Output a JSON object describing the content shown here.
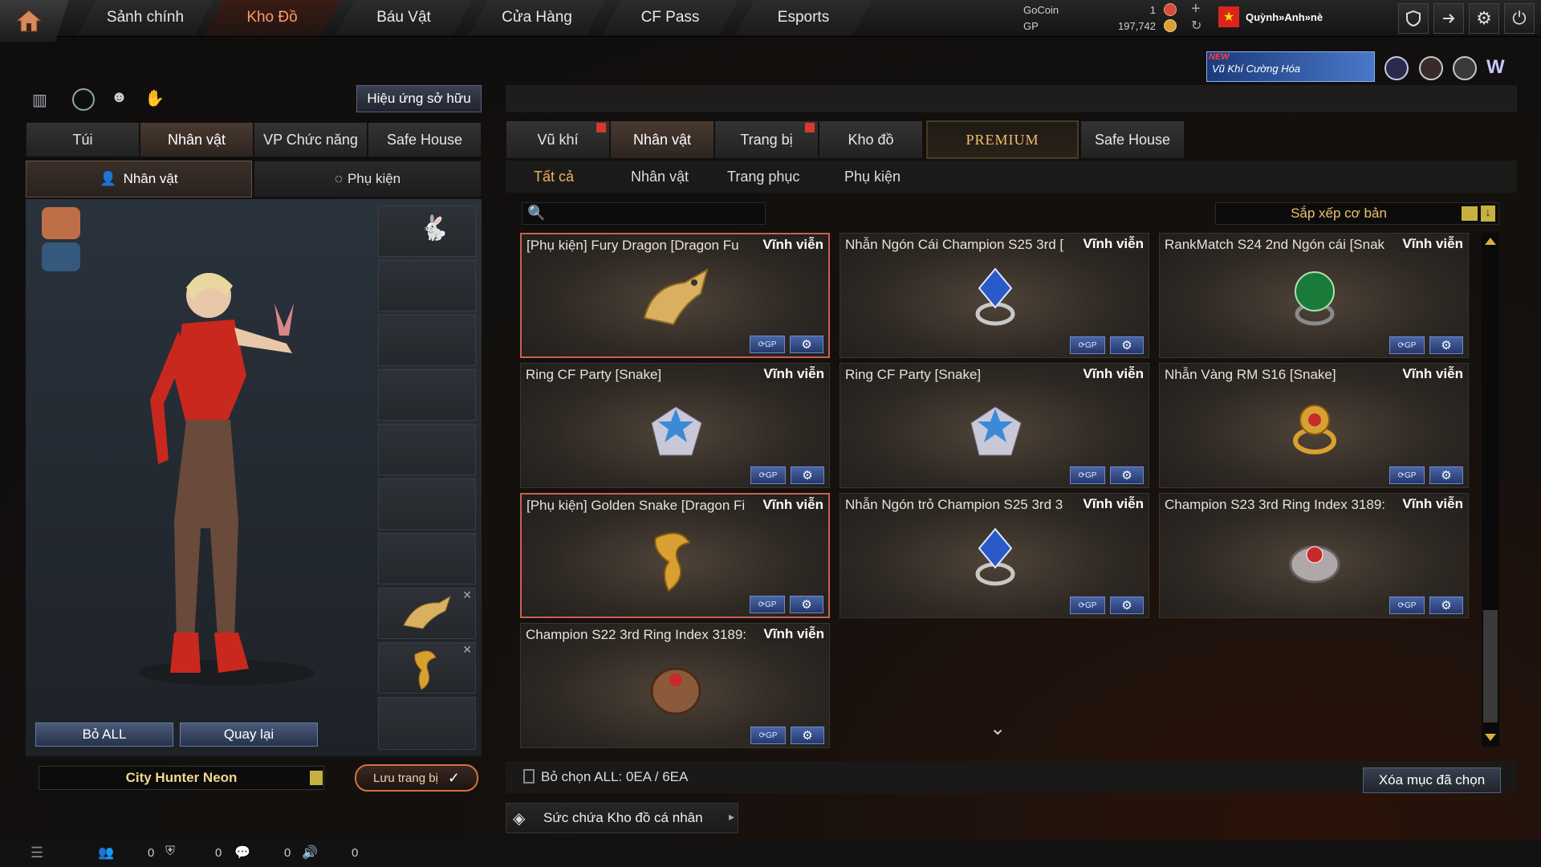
{
  "nav": {
    "tabs": [
      "Sảnh chính",
      "Kho Đồ",
      "Báu Vật",
      "Cửa Hàng",
      "CF Pass",
      "Esports"
    ],
    "active_index": 1
  },
  "currency": {
    "gocoin_label": "GoCoin",
    "gp_label": "GP",
    "gocoin_value": "1",
    "gp_value": "197,742"
  },
  "user": {
    "name": "Quỳnh»Anh»nè",
    "flag": "vn-flag-icon"
  },
  "promo": {
    "new_label": "NEW",
    "text": "Vũ Khí Cường Hóa"
  },
  "left": {
    "effect_button": "Hiệu ứng sở hữu",
    "tabs": [
      "Túi",
      "Nhân vật",
      "VP Chức năng",
      "Safe House"
    ],
    "subtabs": [
      "Nhân vật",
      "Phụ kiện"
    ],
    "remove_all": "Bỏ ALL",
    "back": "Quay lại",
    "character_name": "City Hunter Neon",
    "save_button": "Lưu trang bị"
  },
  "right": {
    "tabs": [
      "Vũ khí",
      "Nhân vật",
      "Trang bị",
      "Kho đồ",
      "PREMIUM",
      "Safe House"
    ],
    "subtabs": [
      "Tất cả",
      "Nhân vật",
      "Trang phục",
      "Phụ kiện"
    ],
    "sort_label": "Sắp xếp cơ bản",
    "search_placeholder": "",
    "items": [
      {
        "name": "[Phụ kiện] Fury Dragon [Dragon Fu",
        "duration": "Vĩnh viễn",
        "icon": "dragon-accessory-icon",
        "selected": true
      },
      {
        "name": "Nhẫn Ngón Cái Champion S25 3rd [",
        "duration": "Vĩnh viễn",
        "icon": "blue-ring-icon",
        "selected": false
      },
      {
        "name": "RankMatch S24 2nd Ngón cái [Snak",
        "duration": "Vĩnh viễn",
        "icon": "green-ring-icon",
        "selected": false
      },
      {
        "name": "Ring CF Party [Snake]",
        "duration": "Vĩnh viễn",
        "icon": "star-ring-icon",
        "selected": false
      },
      {
        "name": "Ring CF Party [Snake]",
        "duration": "Vĩnh viễn",
        "icon": "star-ring-icon",
        "selected": false
      },
      {
        "name": "Nhẫn Vàng RM S16 [Snake]",
        "duration": "Vĩnh viễn",
        "icon": "gold-ring-icon",
        "selected": false
      },
      {
        "name": "[Phụ kiện] Golden Snake [Dragon Fi",
        "duration": "Vĩnh viễn",
        "icon": "golden-snake-icon",
        "selected": true
      },
      {
        "name": "Nhẫn Ngón trỏ Champion S25 3rd 3",
        "duration": "Vĩnh viễn",
        "icon": "blue-ring-icon",
        "selected": false
      },
      {
        "name": "Champion S23 3rd Ring Index 3189:",
        "duration": "Vĩnh viễn",
        "icon": "red-ring-icon",
        "selected": false
      },
      {
        "name": "Champion S22 3rd Ring Index 3189:",
        "duration": "Vĩnh viễn",
        "icon": "bronze-ring-icon",
        "selected": false
      }
    ],
    "select_all": "Bỏ chọn ALL: 0EA / 6EA",
    "delete_button": "Xóa mục đã chọn",
    "capacity": "Sức chứa Kho đồ cá nhân"
  },
  "status": {
    "counts": [
      "0",
      "0",
      "0",
      "0"
    ]
  }
}
